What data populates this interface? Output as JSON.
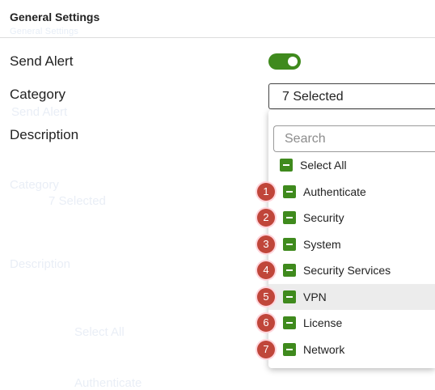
{
  "section": {
    "title": "General Settings",
    "subtitle": "General Settings"
  },
  "fields": {
    "send_alert": {
      "label": "Send Alert",
      "enabled": true
    },
    "category": {
      "label": "Category",
      "value": "7 Selected"
    },
    "description": {
      "label": "Description"
    }
  },
  "dropdown": {
    "search_placeholder": "Search",
    "select_all_label": "Select All",
    "options": [
      {
        "label": "Authenticate",
        "badge": "1",
        "checked": true
      },
      {
        "label": "Security",
        "badge": "2",
        "checked": true
      },
      {
        "label": "System",
        "badge": "3",
        "checked": true
      },
      {
        "label": "Security Services",
        "badge": "4",
        "checked": true
      },
      {
        "label": "VPN",
        "badge": "5",
        "checked": true
      },
      {
        "label": "License",
        "badge": "6",
        "checked": true
      },
      {
        "label": "Network",
        "badge": "7",
        "checked": true
      }
    ]
  },
  "ghost_text": {
    "send_alert": "Send Alert",
    "category": "Category",
    "category_value": "7 Selected",
    "description": "Description",
    "select_all": "Select All",
    "authenticate": "Authenticate"
  },
  "colors": {
    "accent_green": "#3f8a1d",
    "badge_red": "#c0463a",
    "highlight_row": "#ececec"
  }
}
